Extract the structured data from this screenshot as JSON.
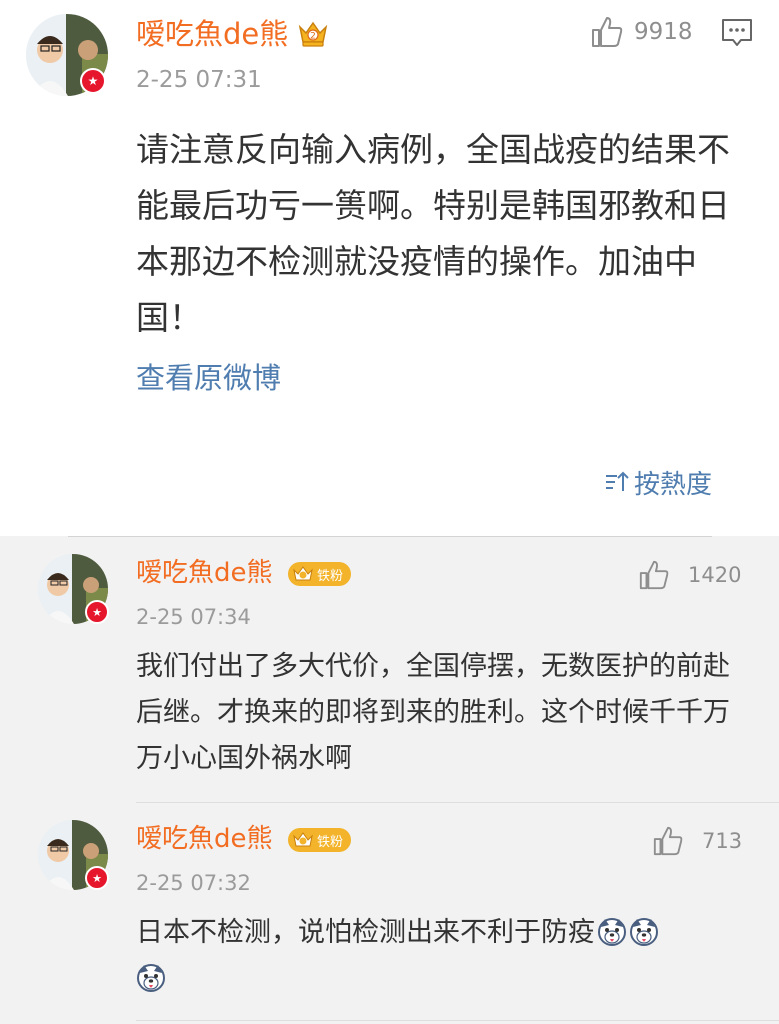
{
  "post": {
    "user": {
      "name": "嗳吃魚de熊",
      "verified": "★"
    },
    "time": "2-25 07:31",
    "likes": "9918",
    "text": "请注意反向输入病例，全国战疫的结果不能最后功亏一篑啊。特别是韩国邪教和日本那边不检测就没疫情的操作。加油中国！",
    "view_original": "查看原微博",
    "sort_label": "按熱度"
  },
  "replies": [
    {
      "name": "嗳吃魚de熊",
      "verified": "★",
      "fan_badge": "铁粉",
      "time": "2-25 07:34",
      "likes": "1420",
      "text": "我们付出了多大代价，全国停摆，无数医护的前赴后继。才换来的即将到来的胜利。这个时候千千万万小心国外祸水啊"
    },
    {
      "name": "嗳吃魚de熊",
      "verified": "★",
      "fan_badge": "铁粉",
      "time": "2-25 07:32",
      "likes": "713",
      "text": "日本不检测，说怕检测出来不利于防疫"
    }
  ],
  "icons": {
    "like": "thumbs-up-icon",
    "comment": "comment-icon",
    "crown": "vip-crown-icon",
    "sort": "sort-icon",
    "emoji": "husky-emoji-icon"
  },
  "colors": {
    "username": "#f26d22",
    "link": "#507daf",
    "verified": "#e6162d",
    "fan_badge": "#f3b32a",
    "reply_bg": "#f2f2f2"
  }
}
